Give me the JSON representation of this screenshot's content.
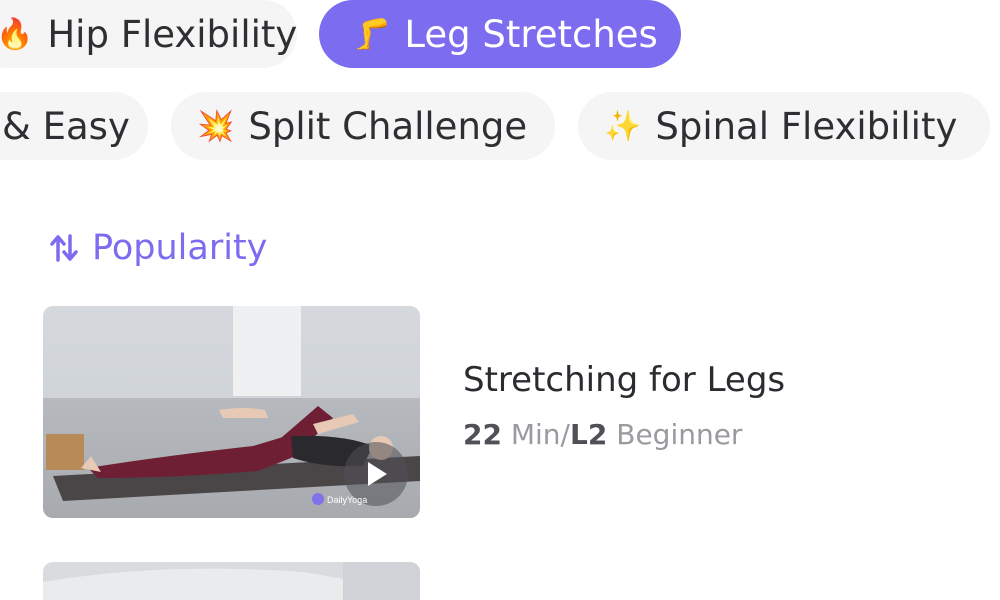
{
  "filters": {
    "row1": [
      {
        "emoji": "🔥",
        "label": "Hip Flexibility",
        "active": false
      },
      {
        "emoji": "🦵",
        "label": "Leg Stretches",
        "active": true
      }
    ],
    "row2": [
      {
        "emoji": "",
        "label": "& Easy",
        "active": false
      },
      {
        "emoji": "💥",
        "label": "Split Challenge",
        "active": false
      },
      {
        "emoji": "✨",
        "label": "Spinal Flexibility",
        "active": false
      }
    ]
  },
  "sort": {
    "icon": "sort-arrows-icon",
    "label": "Popularity"
  },
  "list": [
    {
      "title": "Stretching for Legs",
      "duration": "22",
      "duration_unit": " Min/",
      "level": "L2",
      "level_name": " Beginner",
      "thumbnail_watermark": "DailyYoga",
      "play_icon": "play-icon"
    }
  ],
  "colors": {
    "accent": "#7b6cf0",
    "chip_bg": "#f5f5f6",
    "text_dark": "#2e2e33",
    "text_muted": "#9a9aa0"
  }
}
